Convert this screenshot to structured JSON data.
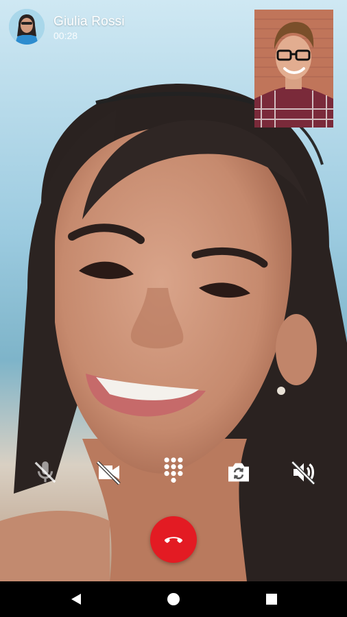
{
  "call": {
    "caller_name": "Giulia Rossi",
    "duration": "00:28",
    "end_call_color": "#e31b23"
  },
  "icons": {
    "avatar": "caller-avatar",
    "self_preview": "self-camera-preview",
    "mute": "microphone-off-icon",
    "video": "video-off-icon",
    "dialpad": "dialpad-icon",
    "switch_camera": "switch-camera-icon",
    "speaker": "speaker-off-icon",
    "end_call": "phone-hangup-icon",
    "nav_back": "back-triangle-icon",
    "nav_home": "home-circle-icon",
    "nav_recents": "recents-square-icon"
  }
}
